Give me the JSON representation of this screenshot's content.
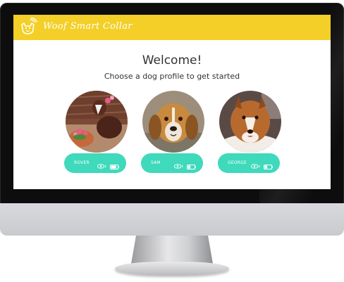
{
  "app": {
    "brand": "Woof Smart Collar",
    "accent_color": "#f3cf28",
    "pill_color": "#3fd9bb"
  },
  "main": {
    "title": "Welcome!",
    "subtitle": "Choose a dog profile to get started"
  },
  "dogs": [
    {
      "name": "ROVER",
      "photo": "dog-photo-rover",
      "battery": 0.8,
      "collar_icon": "collar-signal-icon"
    },
    {
      "name": "SAM",
      "photo": "dog-photo-sam",
      "battery": 0.4,
      "collar_icon": "collar-signal-icon"
    },
    {
      "name": "GEORGE",
      "photo": "dog-photo-george",
      "battery": 0.4,
      "collar_icon": "collar-signal-icon"
    }
  ]
}
